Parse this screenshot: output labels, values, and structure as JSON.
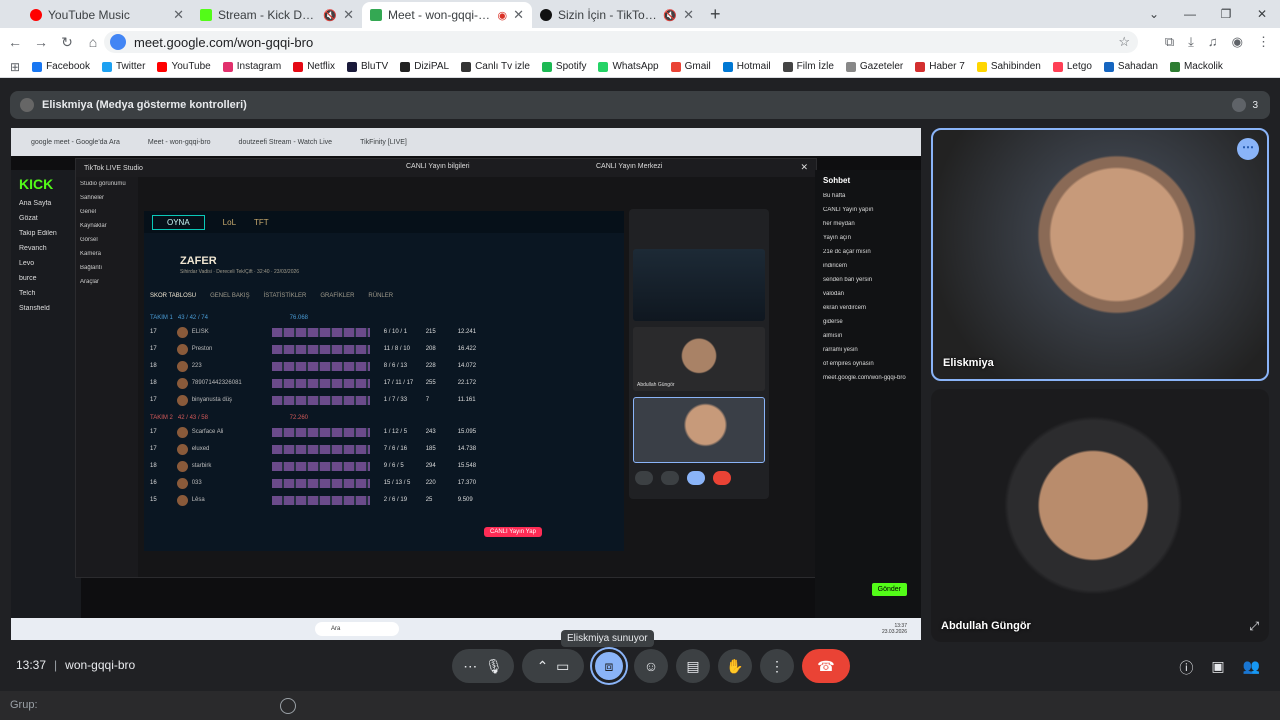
{
  "browser": {
    "tabs": [
      {
        "title": "YouTube Music",
        "color": "#ff0000",
        "active": false
      },
      {
        "title": "Stream - Kick Dashboard",
        "color": "#53fc18",
        "active": false
      },
      {
        "title": "Meet - won-gqqi-bro",
        "color": "#34a853",
        "active": true
      },
      {
        "title": "Sizin İçin - TikTok CANLI Ya",
        "color": "#111111",
        "active": false
      }
    ],
    "url": "meet.google.com/won-gqqi-bro",
    "bookmarks": [
      {
        "label": "Facebook",
        "color": "#1877f2"
      },
      {
        "label": "Twitter",
        "color": "#1da1f2"
      },
      {
        "label": "YouTube",
        "color": "#ff0000"
      },
      {
        "label": "Instagram",
        "color": "#e1306c"
      },
      {
        "label": "Netflix",
        "color": "#e50914"
      },
      {
        "label": "BluTV",
        "color": "#1a1a3a"
      },
      {
        "label": "DiziPAL",
        "color": "#222222"
      },
      {
        "label": "Canlı Tv izle",
        "color": "#333333"
      },
      {
        "label": "Spotify",
        "color": "#1db954"
      },
      {
        "label": "WhatsApp",
        "color": "#25d366"
      },
      {
        "label": "Gmail",
        "color": "#ea4335"
      },
      {
        "label": "Hotmail",
        "color": "#0078d4"
      },
      {
        "label": "Film İzle",
        "color": "#444444"
      },
      {
        "label": "Gazeteler",
        "color": "#888888"
      },
      {
        "label": "Haber 7",
        "color": "#d32f2f"
      },
      {
        "label": "Sahibinden",
        "color": "#ffd600"
      },
      {
        "label": "Letgo",
        "color": "#ff3f55"
      },
      {
        "label": "Sahadan",
        "color": "#1565c0"
      },
      {
        "label": "Mackolik",
        "color": "#2e7d32"
      }
    ]
  },
  "meet": {
    "presenter_bar": "Eliskmiya (Medya gösterme kontrolleri)",
    "participant_count": "3",
    "time": "13:37",
    "meeting_code": "won-gqqi-bro",
    "tooltip": "Eliskmiya sunuyor",
    "participants": [
      {
        "name": "Eliskmiya"
      },
      {
        "name": "Abdullah Güngör"
      }
    ],
    "chat_input_label": "Grup:"
  },
  "shared_screen": {
    "inner_tabs": [
      "google meet - Google'da Ara",
      "Meet - won-gqqi-bro",
      "doutzeefi Stream - Watch Live",
      "TikFinity [LIVE]"
    ],
    "kick_sidebar": [
      "Ana Sayfa",
      "Gözat",
      "Takip Edilen",
      "Revanch",
      "Levo",
      "burce",
      "Telch",
      "Stansfield"
    ],
    "studio_title": "TikTok LIVE Studio",
    "studio_center": "CANLI Yayın bilgileri",
    "studio_right": "CANLI Yayın Merkezi",
    "studio_left": [
      "Studio görünümü",
      "Sahneler",
      "Genel",
      "Kaynaklar",
      "Görsel",
      "Kamera",
      "Bağlantı",
      "Araçlar"
    ],
    "lol_tabs": [
      "OYNA",
      "LoL",
      "TFT"
    ],
    "match_title": "ZAFER",
    "match_sub": "Sihirdar Vadisi · Dereceli Tek/Çift · 32:40 · 23/03/2026",
    "score_tabs": [
      "SKOR TABLOSU",
      "GENEL BAKIŞ",
      "İSTATİSTİKLER",
      "GRAFİKLER",
      "RÜNLER"
    ],
    "team1_label": "TAKIM 1",
    "team1_score": "43 / 42 / 74",
    "team1_gold": "76.068",
    "team2_label": "TAKIM 2",
    "team2_score": "42 / 43 / 58",
    "team2_gold": "72.260",
    "team1": [
      {
        "lvl": "17",
        "name": "ELISK",
        "kda": "6 / 10 / 1",
        "cs": "215",
        "gold": "12.241"
      },
      {
        "lvl": "17",
        "name": "Preston",
        "kda": "11 / 8 / 10",
        "cs": "208",
        "gold": "16.422"
      },
      {
        "lvl": "18",
        "name": "223",
        "kda": "8 / 6 / 13",
        "cs": "228",
        "gold": "14.072"
      },
      {
        "lvl": "18",
        "name": "789071442326081",
        "kda": "17 / 11 / 17",
        "cs": "255",
        "gold": "22.172"
      },
      {
        "lvl": "17",
        "name": "binyanusta düş",
        "kda": "1 / 7 / 33",
        "cs": "7",
        "gold": "11.161"
      }
    ],
    "team2": [
      {
        "lvl": "17",
        "name": "Scarface Ali",
        "kda": "1 / 12 / 5",
        "cs": "243",
        "gold": "15.095"
      },
      {
        "lvl": "17",
        "name": "eluxed",
        "kda": "7 / 6 / 16",
        "cs": "185",
        "gold": "14.738"
      },
      {
        "lvl": "18",
        "name": "starbirk",
        "kda": "9 / 6 / 5",
        "cs": "294",
        "gold": "15.548"
      },
      {
        "lvl": "16",
        "name": "033",
        "kda": "15 / 13 / 5",
        "cs": "220",
        "gold": "17.370"
      },
      {
        "lvl": "15",
        "name": "Lêsa",
        "kda": "2 / 6 / 19",
        "cs": "25",
        "gold": "9.509"
      }
    ],
    "chat_header": "Sohbet",
    "chat_lines": [
      "Bu hafta",
      "CANLI Yayın yapın",
      "her meydan",
      "Yayın açın",
      "21e dc açar mısın",
      "indiricem",
      "senden ban yersin",
      "valodan",
      "ekran verdircem",
      "gidersе",
      "almısın",
      "rarrami yesin",
      "of empires oynasın",
      "meet.google.com/won-gqqi-bro"
    ],
    "chat_send": "Gönder",
    "live_button": "CANLI Yayın Yap",
    "taskbar_search": "Ara",
    "taskbar_time": "13:37",
    "taskbar_date": "23.03.2026",
    "mini_meet_label": "Abdullah Güngör"
  }
}
